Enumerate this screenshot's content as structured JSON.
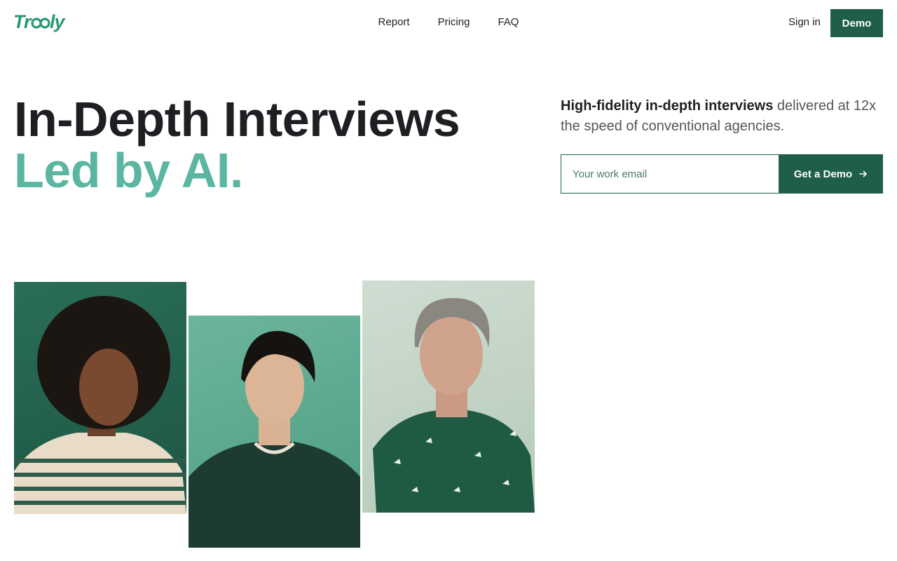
{
  "brand": {
    "logo_text": "Trooly",
    "logo_color": "#2a9a72"
  },
  "nav": {
    "items": [
      "Report",
      "Pricing",
      "FAQ"
    ]
  },
  "header": {
    "signin_label": "Sign in",
    "demo_label": "Demo"
  },
  "hero": {
    "headline": "In-Depth Interviews",
    "headline_accent": "Led by AI.",
    "lede_strong": "High-fidelity in-depth interviews",
    "lede_rest": " delivered at 12x the speed of conventional agencies."
  },
  "signup": {
    "email_placeholder": "Your work email",
    "email_value": "",
    "cta_label": "Get a Demo",
    "cta_icon": "arrow-right-icon"
  },
  "colors": {
    "primary": "#1f5e4a",
    "accent": "#5ab5a1",
    "text": "#1f1f23"
  }
}
